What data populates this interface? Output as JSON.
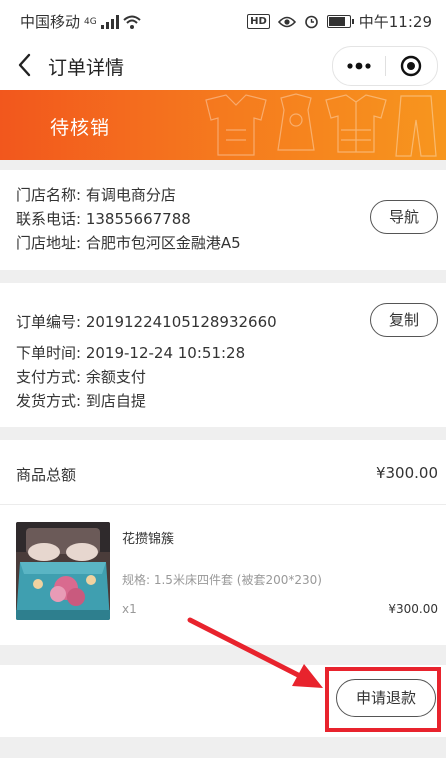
{
  "status_bar": {
    "carrier": "中国移动",
    "network": "4G",
    "hd_badge": "HD",
    "time": "中午11:29"
  },
  "nav": {
    "title": "订单详情"
  },
  "banner": {
    "status": "待核销"
  },
  "store": {
    "name_line": "门店名称: 有调电商分店",
    "phone_line": "联系电话: 13855667788",
    "address_line": "门店地址: 合肥市包河区金融港A5",
    "navigate_label": "导航"
  },
  "order": {
    "number_line": "订单编号: 20191224105128932660",
    "time_line": "下单时间: 2019-12-24 10:51:28",
    "payment_line": "支付方式: 余额支付",
    "delivery_line": "发货方式: 到店自提",
    "copy_label": "复制"
  },
  "summary": {
    "total_label": "商品总额",
    "total_value": "¥300.00"
  },
  "product": {
    "name": "花攒锦簇",
    "spec": "规格: 1.5米床四件套 (被套200*230)",
    "qty": "x1",
    "price": "¥300.00"
  },
  "actions": {
    "refund_label": "申请退款"
  },
  "colors": {
    "banner_start": "#f2571d",
    "banner_end": "#f7961e",
    "highlight": "#e8232d"
  }
}
